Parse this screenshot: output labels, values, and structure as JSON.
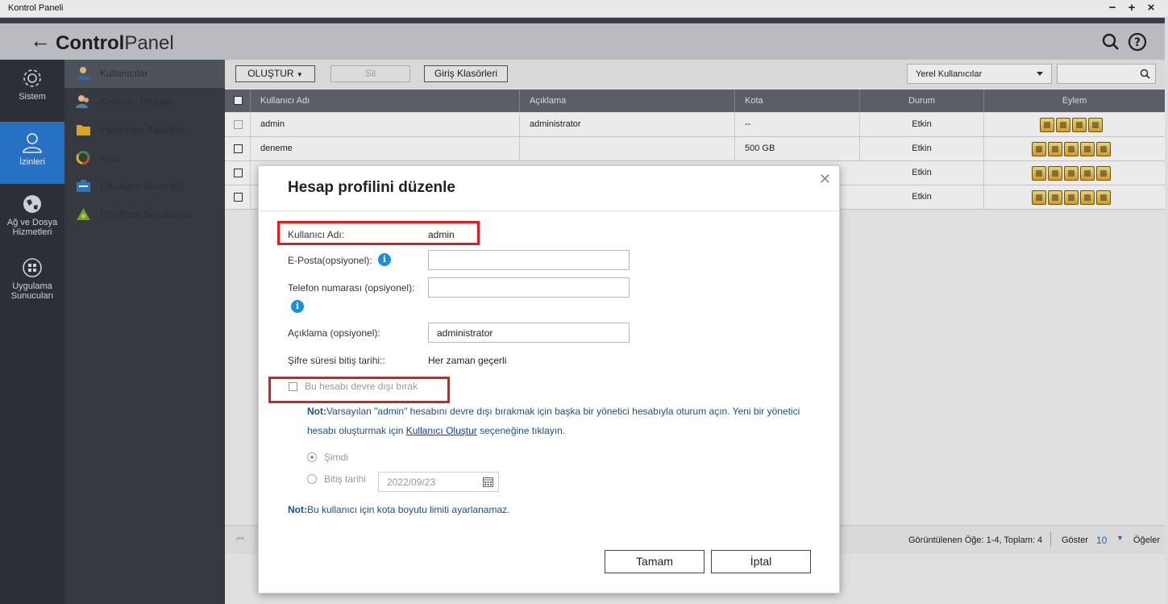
{
  "os": {
    "title": "Kontrol Paneli",
    "minimize": "−",
    "maximize": "+",
    "close": "×"
  },
  "app": {
    "title_bold": "Control",
    "title_light": "Panel"
  },
  "leftnav": [
    {
      "label": "Sistem",
      "icon": "gear-icon"
    },
    {
      "label": "İzinleri",
      "icon": "user-icon",
      "active": true
    },
    {
      "label": "Ağ ve Dosya Hizmetleri",
      "icon": "globe-icon"
    },
    {
      "label": "Uygulama Sunucuları",
      "icon": "apps-icon"
    }
  ],
  "subnav": [
    {
      "label": "Kullanıcılar",
      "icon": "user-icon",
      "active": true
    },
    {
      "label": "Kullanıcı Grupları",
      "icon": "group-icon"
    },
    {
      "label": "Paylaşılan Klasörler",
      "icon": "folder-icon"
    },
    {
      "label": "Kota",
      "icon": "pie-icon"
    },
    {
      "label": "Etki Alanı Güvenliği",
      "icon": "domain-icon"
    },
    {
      "label": "Etki Alanı Denetleyici",
      "icon": "controller-icon"
    }
  ],
  "toolbar": {
    "create": "OLUŞTUR",
    "delete": "Sil",
    "home_folders": "Giriş Klasörleri",
    "filter": "Yerel Kullanıcılar"
  },
  "table": {
    "headers": {
      "username": "Kullanıcı Adı",
      "description": "Açıklama",
      "quota": "Kota",
      "status": "Durum",
      "action": "Eylem"
    },
    "rows": [
      {
        "username": "admin",
        "description": "administrator",
        "quota": "--",
        "status": "Etkin"
      },
      {
        "username": "deneme",
        "description": "",
        "quota": "500 GB",
        "status": "Etkin"
      },
      {
        "username": "",
        "description": "",
        "quota": "",
        "status": "Etkin"
      },
      {
        "username": "",
        "description": "",
        "quota": "",
        "status": "Etkin"
      }
    ]
  },
  "footer": {
    "displayed": "Görüntülenen Öğe: 1-4, Toplam: 4",
    "show": "Göster",
    "page_size": "10",
    "items": "Öğeler"
  },
  "dialog": {
    "title": "Hesap profilini düzenle",
    "username_label": "Kullanıcı Adı:",
    "username_value": "admin",
    "email_label": "E-Posta(opsiyonel):",
    "phone_label": "Telefon numarası (opsiyonel):",
    "description_label": "Açıklama (opsiyonel):",
    "description_value": "administrator",
    "password_expiry_label": "Şifre süresi bitiş tarihi::",
    "password_expiry_value": "Her zaman geçerli",
    "disable_account_label": "Bu hesabı devre dışı bırak",
    "note1_prefix": "Not:",
    "note1_text_a": "Varsayılan \"admin\" hesabını devre dışı bırakmak için başka bir yönetici hesabıyla oturum açın. Yeni bir yönetici",
    "note1_text_b": "hesabı oluşturmak için",
    "note1_link": "Kullanıcı Oluştur",
    "note1_text_c": "seçeneğine tıklayın.",
    "radio_now": "Şimdi",
    "radio_end_date": "Bitiş tarihi",
    "end_date_value": "2022/09/23",
    "note2_prefix": "Not:",
    "note2_text": "Bu kullanıcı için kota boyutu limiti ayarlanamaz.",
    "ok": "Tamam",
    "cancel": "İptal"
  }
}
